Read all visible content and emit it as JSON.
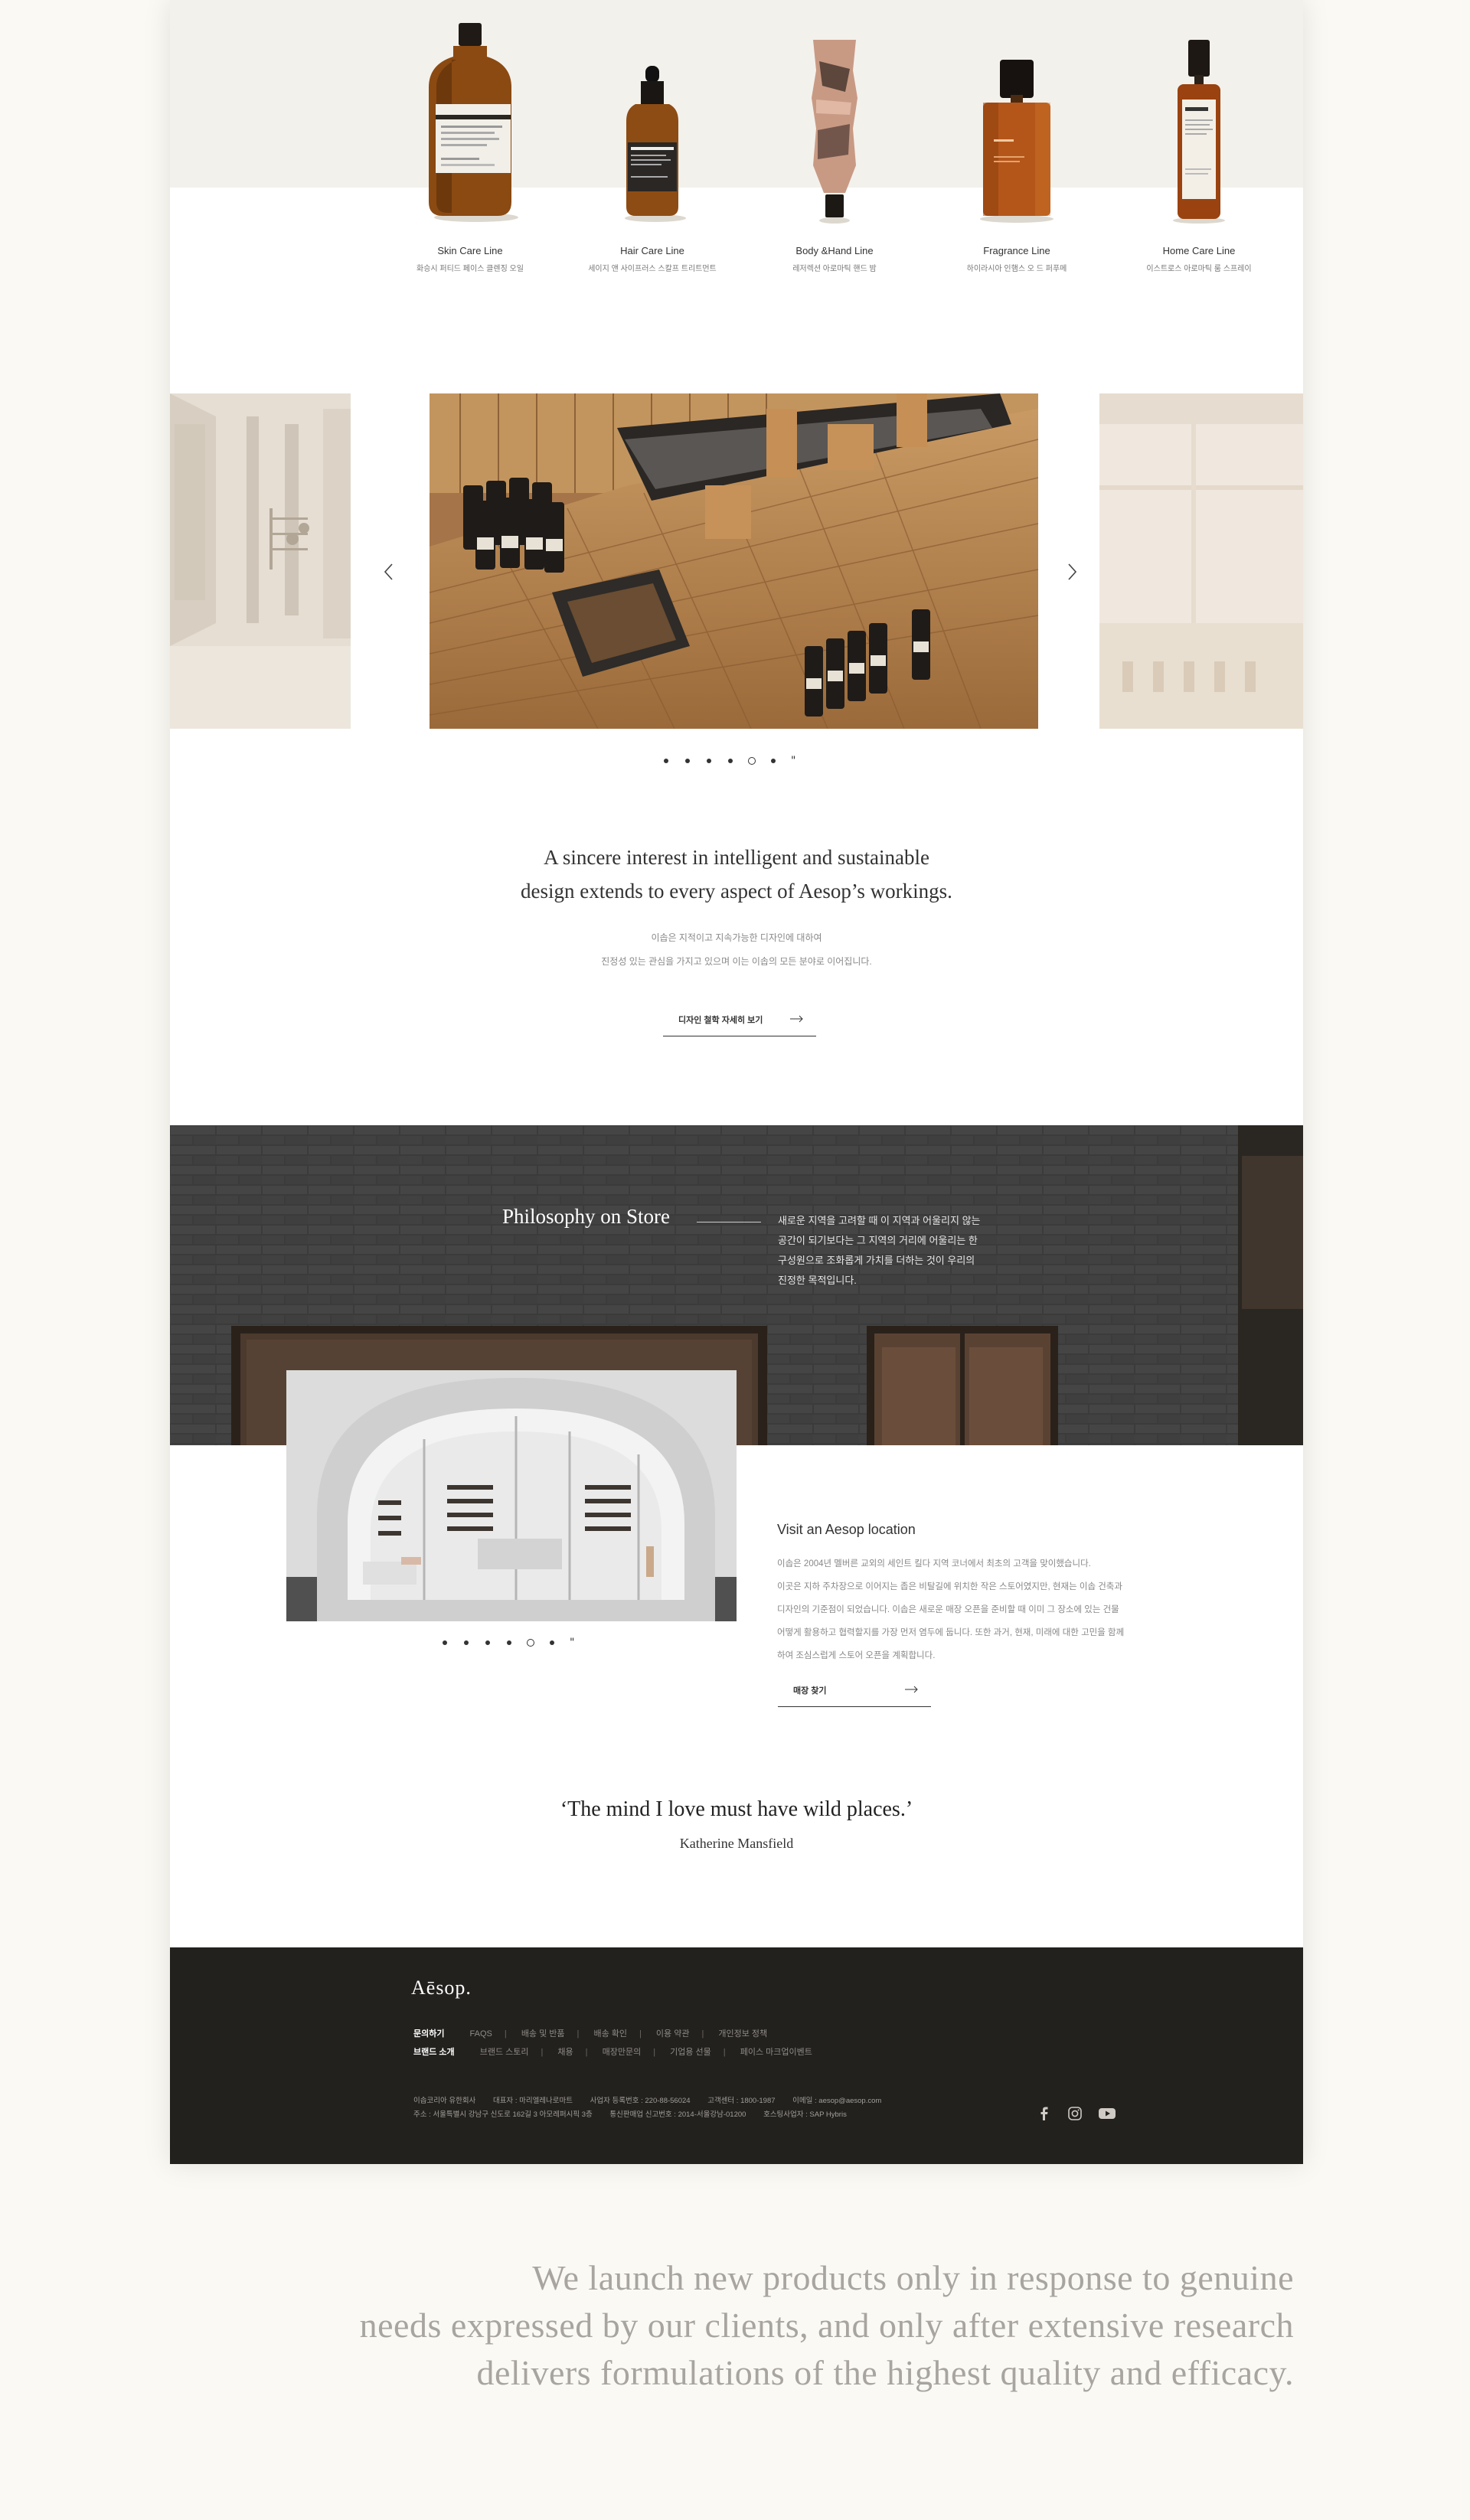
{
  "products": [
    {
      "name": "Skin Care Line",
      "sub": "화승시 퍼티드 페이스 클렌징 오일"
    },
    {
      "name": "Hair Care Line",
      "sub": "세이지 앤 사이프러스 스칼프 트리트먼트"
    },
    {
      "name": "Body &Hand Line",
      "sub": "레저렉션 아로마틱 핸드 밤"
    },
    {
      "name": "Fragrance Line",
      "sub": "하이라시아 인햄스 오 드 퍼푸메"
    },
    {
      "name": "Home Care Line",
      "sub": "이스트로스 아로마틱 룸 스프레이"
    }
  ],
  "intro": {
    "line1": "A sincere interest in intelligent and sustainable",
    "line2": "design extends to every aspect of Aesop’s workings.",
    "ko1": "이솝은 지적이고 지속가능한 디자인에 대하여",
    "ko2": "진정성 있는 관심을 가지고 있으며 이는 이솝의 모든 분야로 이어집니다.",
    "button": "디자인 철학 자세히 보기"
  },
  "store": {
    "title": "Philosophy on Store",
    "desc": [
      "새로운 지역을 고려할 때 이 지역과 어울리지 않는",
      "공간이 되기보다는 그 지역의 거리에 어울리는 한",
      "구성원으로 조화롭게 가치를 더하는 것이 우리의",
      "진정한 목적입니다."
    ],
    "visit_title": "Visit an Aesop location",
    "visit_desc": [
      "이솝은 2004년 멜버른 교외의 세인트 킬다 지역 코너에서 최초의 고객을 맞이했습니다.",
      "이곳은 지하 주차장으로 이어지는 좁은 비탈길에 위치한 작은 스토어였지만, 현재는 이솝 건축과",
      "디자인의 기준점이 되었습니다. 이솝은 새로운 매장 오픈을 준비할 때 이미 그 장소에 있는 건물",
      "어떻게 활용하고 협력할지를 가장 먼저 염두에 둡니다. 또한 과거, 현재, 미래에 대한 고민을 함께",
      "하여 조심스럽게 스토어 오픈을 계획합니다."
    ],
    "button": "매장 찾기"
  },
  "quote": {
    "text": "‘The mind I love must have wild places.’",
    "author": "Katherine Mansfield"
  },
  "carousel": {
    "dots": 6,
    "active_index": 4
  },
  "footer": {
    "logo": "Aēsop.",
    "row1_label": "문의하기",
    "row1": [
      "FAQS",
      "배송 및 반품",
      "배송 확인",
      "이용 약관",
      "개인정보 정책"
    ],
    "row2_label": "브랜드 소개",
    "row2": [
      "브랜드 스토리",
      "채용",
      "매장만문의",
      "기업용 선물",
      "페이스 마크업이벤트"
    ],
    "info1": [
      "이솝코리아 유한회사",
      "대표자 : 마리엘레나로마트",
      "사업자 등록번호 : 220-88-56024",
      "고객센터 : 1800-1987",
      "이메일 : aesop@aesop.com"
    ],
    "info2": [
      "주소 : 서울특별시 강남구 신도로 162길 3 아모레퍼시픽 3층",
      "통신판매업 신고번호 : 2014-서울강남-01200",
      "호스팅사업자 : SAP Hybris"
    ]
  },
  "tagline": [
    "We launch new products only in response to genuine",
    "needs expressed by our clients, and only after extensive research",
    "delivers formulations of the highest quality and efficacy."
  ],
  "colors": {
    "page_bg": "#fbf9f3",
    "footer_bg": "#23211e",
    "store_band": "#3a3a3a",
    "product_band": "#f3f1ec"
  }
}
